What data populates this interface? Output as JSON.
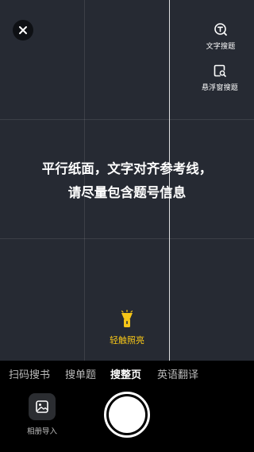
{
  "camera": {
    "close_label": "close",
    "tools": [
      {
        "icon": "text-search-icon",
        "label": "文字搜题"
      },
      {
        "icon": "floating-window-search-icon",
        "label": "悬浮窗搜题"
      }
    ],
    "guide": {
      "line1": "平行纸面，文字对齐参考线，",
      "line2": "请尽量包含题号信息"
    },
    "torch": {
      "icon": "flashlight-icon",
      "label": "轻触照亮",
      "color": "#f5c518"
    }
  },
  "modes": {
    "tabs": [
      "扫码搜书",
      "搜单题",
      "搜整页",
      "英语翻译"
    ],
    "active": "搜整页"
  },
  "bottom": {
    "album": {
      "icon": "photo-album-icon",
      "label": "相册导入"
    },
    "shutter": "shutter-button"
  },
  "colors": {
    "camera_bg": "#262a33",
    "accent_yellow": "#f5c518",
    "bar_bg": "#000000"
  }
}
